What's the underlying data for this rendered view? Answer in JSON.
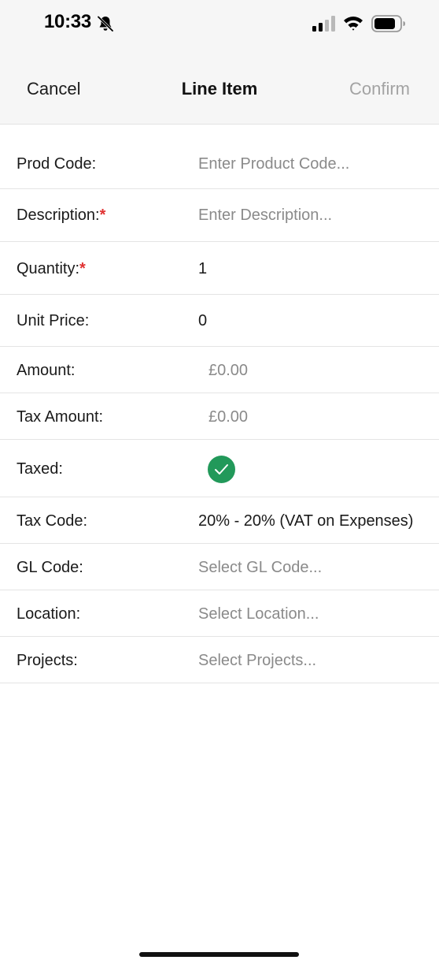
{
  "status_bar": {
    "time": "10:33",
    "icons": [
      "bell-slash-icon",
      "cellular-signal-icon",
      "wifi-icon",
      "battery-icon"
    ]
  },
  "header": {
    "cancel_label": "Cancel",
    "title": "Line Item",
    "confirm_label": "Confirm"
  },
  "form": {
    "prod_code": {
      "label": "Prod Code:",
      "placeholder": "Enter Product Code...",
      "value": ""
    },
    "description": {
      "label": "Description:",
      "required_mark": "*",
      "placeholder": "Enter Description...",
      "value": ""
    },
    "quantity": {
      "label": "Quantity:",
      "required_mark": "*",
      "value": "1"
    },
    "unit_price": {
      "label": "Unit Price:",
      "value": "0"
    },
    "amount": {
      "label": "Amount:",
      "value": "£0.00"
    },
    "tax_amount": {
      "label": "Tax Amount:",
      "value": "£0.00"
    },
    "taxed": {
      "label": "Taxed:",
      "checked": true,
      "icon": "checkmark-circle-icon"
    },
    "tax_code": {
      "label": "Tax Code:",
      "value": "20% - 20% (VAT on Expenses)"
    },
    "gl_code": {
      "label": "GL Code:",
      "placeholder": "Select GL Code..."
    },
    "location": {
      "label": "Location:",
      "placeholder": "Select Location..."
    },
    "projects": {
      "label": "Projects:",
      "placeholder": "Select Projects..."
    }
  },
  "colors": {
    "header_bg": "#f6f6f6",
    "required": "#e03131",
    "check_green": "#22995a",
    "placeholder": "#8a8a8a",
    "confirm_disabled": "#a3a3a3"
  }
}
